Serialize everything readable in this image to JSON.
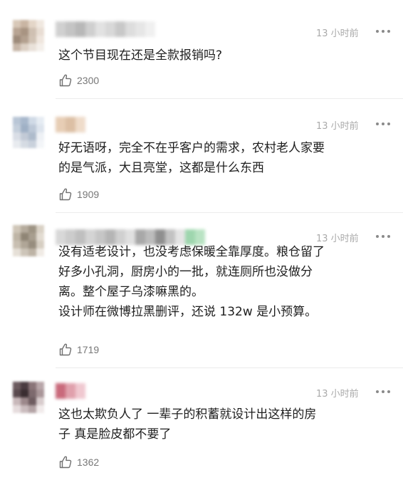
{
  "comments": [
    {
      "time": "13 小时前",
      "text": "这个节目现在还是全款报销吗?",
      "likes": "2300",
      "more_icon": "more-dots-icon",
      "like_icon": "thumbs-up-icon",
      "avatar_colors": [
        "#d8c8b8",
        "#c9b5a3",
        "#e4d6c8",
        "#f0e8e0",
        "#b8a493",
        "#a89482",
        "#cfc0b2",
        "#e8ddd3",
        "#9e8b7b",
        "#b3a08f",
        "#d1c3b5",
        "#efe6de",
        "#c7b6a8",
        "#dcd0c4",
        "#e9e1d9",
        "#f4efea"
      ],
      "name_colors": [
        "#d0d0d0",
        "#c4c4c4",
        "#b8b8b8",
        "#cfcfcf",
        "#e2e2e2",
        "#d8d8d8",
        "#c8c8c8",
        "#dddddd",
        "#e6e6e6",
        "#f0f0f0"
      ]
    },
    {
      "time": "13 小时前",
      "text": "好无语呀，完全不在乎客户的需求，农村老人家要\n的是气派，大且亮堂，这都是什么东西",
      "likes": "1909",
      "more_icon": "more-dots-icon",
      "like_icon": "thumbs-up-icon",
      "avatar_colors": [
        "#b9c6d6",
        "#a8b8cc",
        "#d0dae6",
        "#e6ecf3",
        "#c5cfdc",
        "#9fb0c5",
        "#bcc8d7",
        "#dde4ed",
        "#d9dee6",
        "#c2cad6",
        "#aebbcb",
        "#eef1f5",
        "#e8ebef",
        "#d5dbe3",
        "#c9d1dc",
        "#f3f5f8"
      ],
      "name_colors": [
        "#e7cdb5",
        "#dcbfa4",
        "#efdcca"
      ]
    },
    {
      "time": "13 小时前",
      "text": "没有适老设计，也没考虑保暖全靠厚度。粮仓留了\n好多小孔洞，厨房小的一批，就连厕所也没做分\n离。整个屋子乌漆嘛黑的。\n设计师在微博拉黑删评，还说 132w 是小预算。",
      "likes": "1719",
      "more_icon": "more-dots-icon",
      "like_icon": "thumbs-up-icon",
      "avatar_colors": [
        "#cfc6b8",
        "#b5ab9c",
        "#9e9484",
        "#d9d1c5",
        "#bfb5a6",
        "#8f8575",
        "#a89e8f",
        "#e2dbd1",
        "#c8bfb1",
        "#b0a697",
        "#978d7e",
        "#d6cec2",
        "#e6e0d7",
        "#cdc5b9",
        "#bdb3a5",
        "#f0ebe5"
      ],
      "name_colors": [
        "#d8d8d8",
        "#cccccc",
        "#bfbfbf",
        "#d4d4d4",
        "#c6c6c6",
        "#b5b5b5",
        "#d0d0d0",
        "#e0e0e0",
        "#a8a8a8",
        "#bcbcbc",
        "#8f8f8f",
        "#c2c2c2",
        "#e4e4e4",
        "#9ed6ae",
        "#b9e3c3"
      ]
    },
    {
      "time": "13 小时前",
      "text": "这也太欺负人了 一辈子的积蓄就设计出这样的房\n子 真是脸皮都不要了",
      "likes": "1362",
      "more_icon": "more-dots-icon",
      "like_icon": "thumbs-up-icon",
      "avatar_colors": [
        "#6b5a5e",
        "#4a3b40",
        "#8a7478",
        "#b8a6a9",
        "#5a4a4e",
        "#3a2d31",
        "#7d6a6e",
        "#a99699",
        "#c8b8ba",
        "#9c888b",
        "#6e5c60",
        "#d8cccd",
        "#e6dcdd",
        "#cabcbe",
        "#b3a3a5",
        "#f1ebeb"
      ],
      "name_colors": [
        "#c96a7b",
        "#e0a0ac",
        "#f0c8d0"
      ]
    }
  ]
}
